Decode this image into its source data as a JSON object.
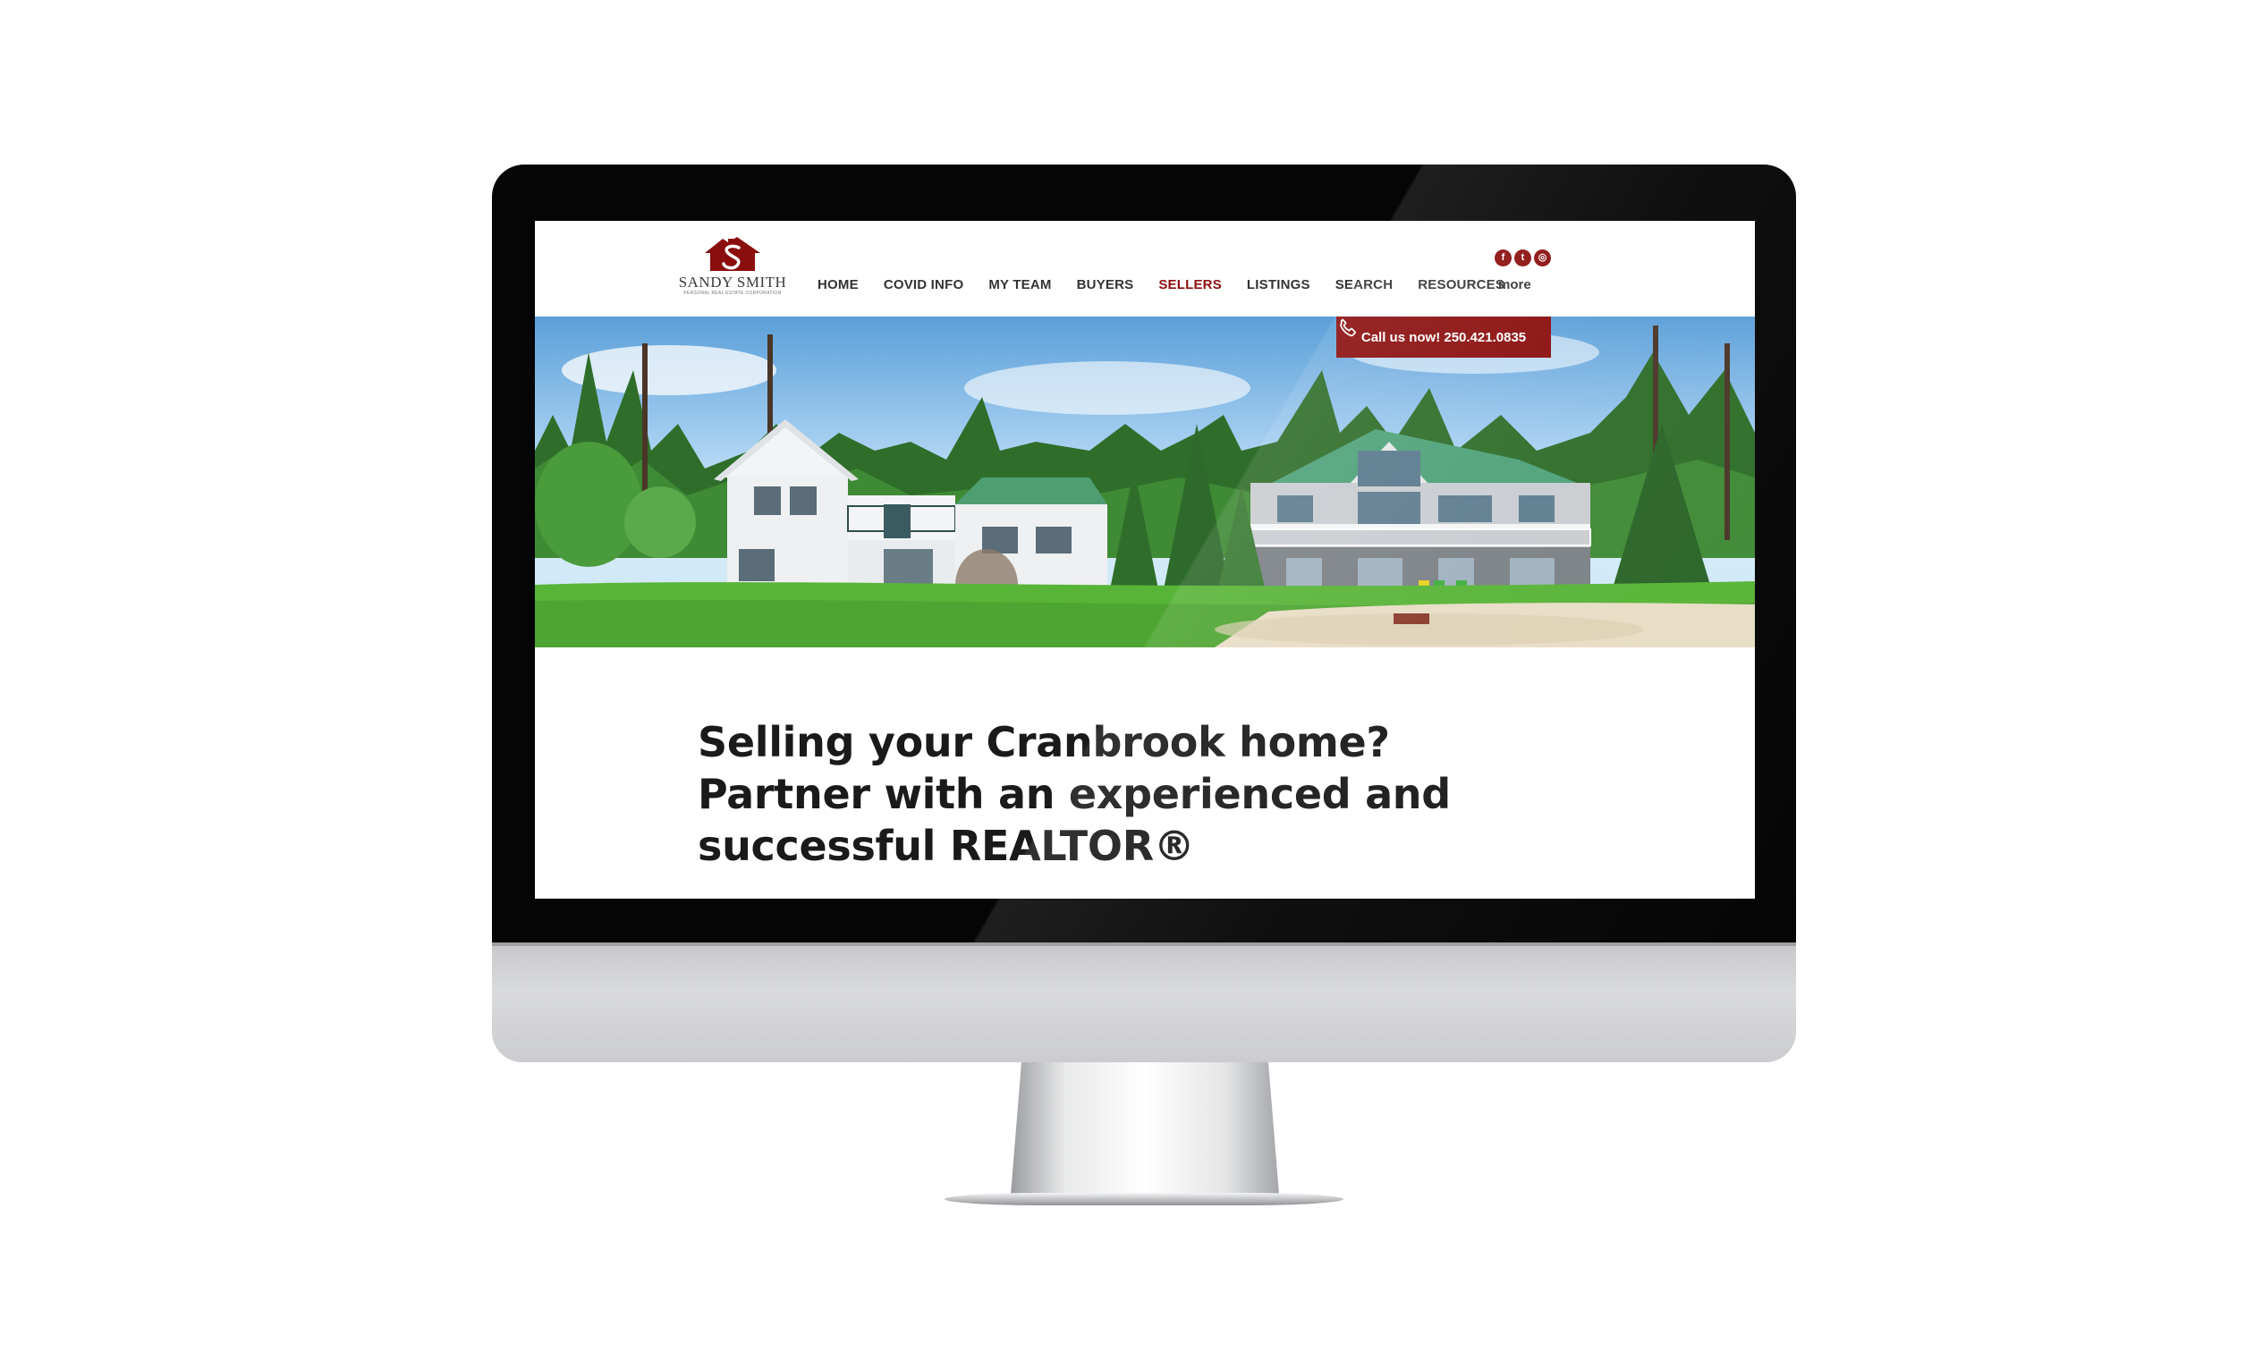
{
  "logo": {
    "name": "SANDY SMITH",
    "tagline": "PERSONAL REAL ESTATE CORPORATION"
  },
  "nav": {
    "items": [
      {
        "label": "HOME",
        "active": false
      },
      {
        "label": "COVID INFO",
        "active": false
      },
      {
        "label": "MY TEAM",
        "active": false
      },
      {
        "label": "BUYERS",
        "active": false
      },
      {
        "label": "SELLERS",
        "active": true
      },
      {
        "label": "LISTINGS",
        "active": false
      },
      {
        "label": "SEARCH",
        "active": false
      },
      {
        "label": "RESOURCES",
        "active": false
      }
    ],
    "more_label": "more"
  },
  "socials": [
    {
      "icon": "facebook-icon",
      "glyph": "f"
    },
    {
      "icon": "twitter-icon",
      "glyph": "t"
    },
    {
      "icon": "instagram-icon",
      "glyph": "◎"
    }
  ],
  "hero": {
    "call_label": "Call us now! 250.421.0835",
    "image": "lakefront-house-with-green-roof"
  },
  "headline": {
    "line1": "Selling your Cranbrook home?",
    "line2": "Partner with an experienced and",
    "line3": "successful REALTOR®"
  },
  "colors": {
    "brand": "#8b0e0e",
    "text": "#1a1a1a",
    "nav_text": "#333333"
  }
}
